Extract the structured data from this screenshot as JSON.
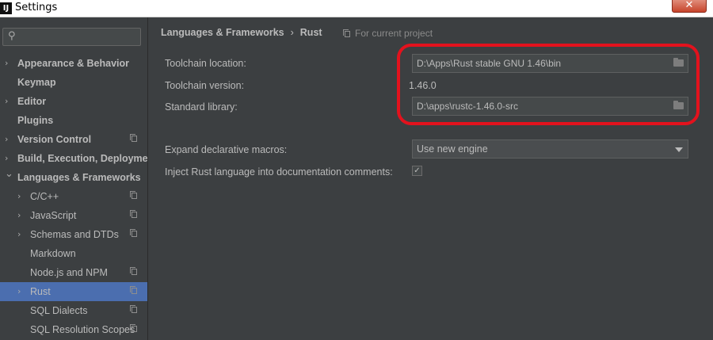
{
  "window": {
    "title": "Settings",
    "app_icon": "intellij-icon",
    "close": "✕"
  },
  "sidebar": {
    "search": {
      "icon": "search-icon",
      "value": ""
    },
    "items": [
      {
        "label": "Appearance & Behavior",
        "expandable": true,
        "bold": true,
        "level": 0,
        "project": false,
        "selected": false
      },
      {
        "label": "Keymap",
        "expandable": false,
        "bold": true,
        "level": 0,
        "project": false,
        "selected": false
      },
      {
        "label": "Editor",
        "expandable": true,
        "bold": true,
        "level": 0,
        "project": false,
        "selected": false
      },
      {
        "label": "Plugins",
        "expandable": false,
        "bold": true,
        "level": 0,
        "project": false,
        "selected": false
      },
      {
        "label": "Version Control",
        "expandable": true,
        "bold": true,
        "level": 0,
        "project": true,
        "selected": false
      },
      {
        "label": "Build, Execution, Deployment",
        "expandable": true,
        "bold": true,
        "level": 0,
        "project": false,
        "selected": false
      },
      {
        "label": "Languages & Frameworks",
        "expandable": true,
        "expanded": true,
        "bold": true,
        "level": 0,
        "project": false,
        "selected": false
      },
      {
        "label": "C/C++",
        "expandable": true,
        "bold": false,
        "level": 1,
        "project": true,
        "selected": false
      },
      {
        "label": "JavaScript",
        "expandable": true,
        "bold": false,
        "level": 1,
        "project": true,
        "selected": false
      },
      {
        "label": "Schemas and DTDs",
        "expandable": true,
        "bold": false,
        "level": 1,
        "project": true,
        "selected": false
      },
      {
        "label": "Markdown",
        "expandable": false,
        "bold": false,
        "level": 1,
        "project": false,
        "selected": false
      },
      {
        "label": "Node.js and NPM",
        "expandable": false,
        "bold": false,
        "level": 1,
        "project": true,
        "selected": false
      },
      {
        "label": "Rust",
        "expandable": true,
        "bold": false,
        "level": 1,
        "project": true,
        "selected": true
      },
      {
        "label": "SQL Dialects",
        "expandable": false,
        "bold": false,
        "level": 1,
        "project": true,
        "selected": false
      },
      {
        "label": "SQL Resolution Scopes",
        "expandable": false,
        "bold": false,
        "level": 1,
        "project": true,
        "selected": false
      }
    ]
  },
  "breadcrumb": {
    "parent": "Languages & Frameworks",
    "separator": "›",
    "current": "Rust",
    "project_note": "For current project"
  },
  "form": {
    "toolchain_location": {
      "label": "Toolchain location:",
      "value": "D:\\Apps\\Rust stable GNU 1.46\\bin"
    },
    "toolchain_version": {
      "label": "Toolchain version:",
      "value": "1.46.0"
    },
    "standard_library": {
      "label": "Standard library:",
      "value": "D:\\apps\\rustc-1.46.0-src"
    },
    "expand_macros": {
      "label": "Expand declarative macros:",
      "value": "Use new engine"
    },
    "inject_rust": {
      "label": "Inject Rust language into documentation comments:",
      "checked": true,
      "mark": "✓"
    }
  },
  "colors": {
    "background": "#3c3f41",
    "selection": "#4b6eaf",
    "highlight": "#e3121d",
    "text": "#bbbbbb"
  }
}
